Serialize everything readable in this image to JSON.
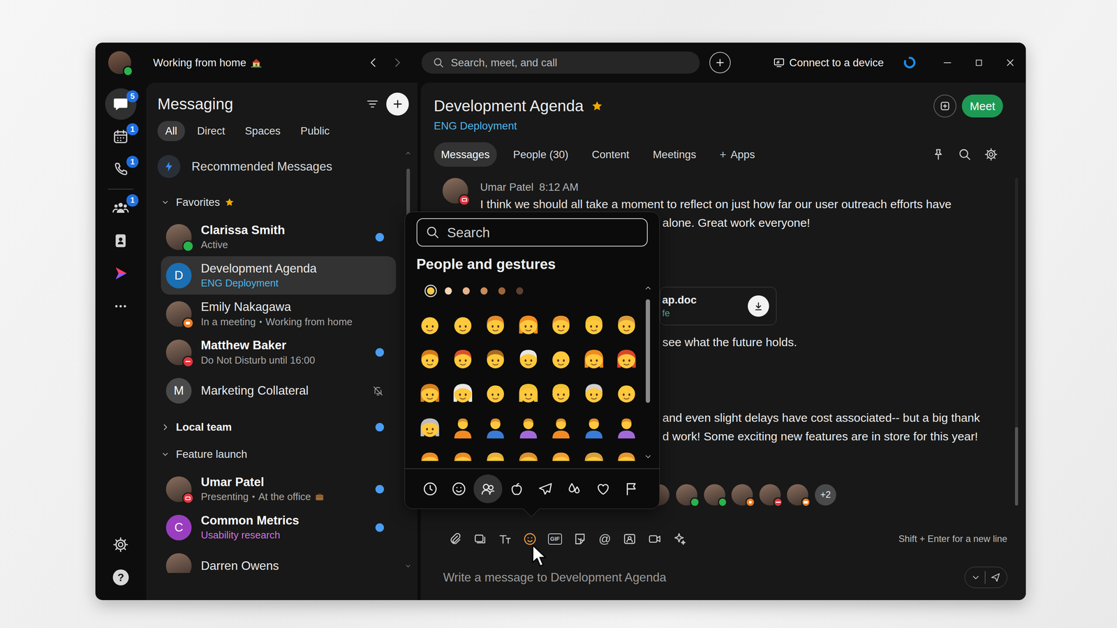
{
  "topbar": {
    "status": "Working from home",
    "status_icon": true,
    "presence": "active",
    "back_enabled": true,
    "forward_enabled": false,
    "search_placeholder": "Search, meet, and call",
    "connect": "Connect to a device"
  },
  "rail": {
    "items": [
      {
        "kind": "chat",
        "badge": "5",
        "selected": true
      },
      {
        "kind": "calendar",
        "badge": "1",
        "selected": false
      },
      {
        "kind": "calls",
        "badge": "1",
        "selected": false
      },
      {
        "kind": "teams",
        "badge": "1",
        "selected": false
      },
      {
        "kind": "contacts",
        "badge": null,
        "selected": false
      },
      {
        "kind": "app",
        "badge": null,
        "selected": false
      },
      {
        "kind": "more",
        "badge": null,
        "selected": false
      }
    ],
    "bottom": [
      {
        "kind": "settings",
        "glyph": null
      },
      {
        "kind": "help",
        "glyph": "?"
      }
    ]
  },
  "messaging": {
    "title": "Messaging",
    "filters": [
      {
        "label": "All",
        "selected": true
      },
      {
        "label": "Direct",
        "selected": false
      },
      {
        "label": "Spaces",
        "selected": false
      },
      {
        "label": "Public",
        "selected": false
      }
    ],
    "recommended": "Recommended Messages",
    "subtitle_separator": "•",
    "sections": [
      {
        "title": "Favorites",
        "expanded": true,
        "starred": true,
        "unread": false,
        "items": [
          {
            "name": "Clarissa Smith",
            "subtitle": [
              "Active"
            ],
            "subtitle_color": null,
            "status_icon": false,
            "avatar": {
              "kind": "photo"
            },
            "presence": "active",
            "unread": true,
            "muted": false,
            "selected": false
          },
          {
            "name": "Development Agenda",
            "subtitle": [
              "ENG Deployment"
            ],
            "subtitle_color": "#4fb6e8",
            "status_icon": false,
            "avatar": {
              "kind": "letter",
              "initial": "D",
              "color": "#1b6fb3"
            },
            "presence": "none",
            "unread": false,
            "muted": false,
            "selected": true
          },
          {
            "name": "Emily Nakagawa",
            "subtitle": [
              "In a meeting",
              "Working from home"
            ],
            "subtitle_color": null,
            "status_icon": false,
            "avatar": {
              "kind": "photo"
            },
            "presence": "meeting",
            "unread": false,
            "muted": false,
            "selected": false
          },
          {
            "name": "Matthew Baker",
            "subtitle": [
              "Do Not Disturb until 16:00"
            ],
            "subtitle_color": null,
            "status_icon": false,
            "avatar": {
              "kind": "photo"
            },
            "presence": "dnd",
            "unread": true,
            "muted": false,
            "selected": false
          },
          {
            "name": "Marketing Collateral",
            "subtitle": [],
            "subtitle_color": null,
            "status_icon": false,
            "avatar": {
              "kind": "letter",
              "initial": "M",
              "color": "#4a4a4a"
            },
            "presence": "none",
            "unread": false,
            "muted": true,
            "selected": false
          }
        ]
      },
      {
        "title": "Local team",
        "expanded": false,
        "starred": false,
        "unread": true,
        "items": []
      },
      {
        "title": "Feature launch",
        "expanded": true,
        "starred": false,
        "unread": false,
        "items": [
          {
            "name": "Umar Patel",
            "subtitle": [
              "Presenting",
              "At the office"
            ],
            "subtitle_color": null,
            "status_icon": true,
            "avatar": {
              "kind": "photo"
            },
            "presence": "presenting",
            "unread": true,
            "muted": false,
            "selected": false
          },
          {
            "name": "Common Metrics",
            "subtitle": [
              "Usability research"
            ],
            "subtitle_color": "#cf72e6",
            "status_icon": false,
            "avatar": {
              "kind": "letter",
              "initial": "C",
              "color": "#9a3ec0"
            },
            "presence": "none",
            "unread": true,
            "muted": false,
            "selected": false
          },
          {
            "name": "Darren Owens",
            "subtitle": [],
            "subtitle_color": null,
            "status_icon": false,
            "avatar": {
              "kind": "photo"
            },
            "presence": "none",
            "unread": false,
            "muted": false,
            "selected": false
          }
        ]
      }
    ]
  },
  "space": {
    "title": "Development Agenda",
    "favorite": true,
    "subtitle": "ENG Deployment",
    "meet": "Meet",
    "tabs": [
      {
        "label": "Messages",
        "prefix": null,
        "selected": true
      },
      {
        "label": "People (30)",
        "prefix": null,
        "selected": false
      },
      {
        "label": "Content",
        "prefix": null,
        "selected": false
      },
      {
        "label": "Meetings",
        "prefix": null,
        "selected": false
      },
      {
        "label": "Apps",
        "prefix": "+",
        "selected": false
      }
    ],
    "tools": [
      {
        "kind": "pin"
      },
      {
        "kind": "search"
      },
      {
        "kind": "settings"
      }
    ]
  },
  "message": {
    "author": "Umar Patel",
    "time": "8:12 AM",
    "presence": "presenting",
    "body": [
      {
        "kind": "text",
        "text": "I think we should all take a moment to reflect on just how far our user outreach efforts have"
      },
      {
        "kind": "text",
        "text": "alone. Great work everyone!"
      },
      {
        "kind": "file",
        "name": "ap.doc",
        "meta": "fe"
      },
      {
        "kind": "text",
        "text": "see what the future holds."
      },
      {
        "kind": "text",
        "text": "and even slight delays have cost associated-- but a big thank"
      },
      {
        "kind": "text",
        "text": "d work! Some exciting new features are in store for this year!"
      }
    ],
    "readers": [
      {
        "presence": "none"
      },
      {
        "presence": "active"
      },
      {
        "presence": "active"
      },
      {
        "presence": "calling"
      },
      {
        "presence": "dnd"
      },
      {
        "presence": "meeting"
      }
    ],
    "more_readers": "+2"
  },
  "composer": {
    "tools": [
      {
        "kind": "attach",
        "glyph": null,
        "selected": false
      },
      {
        "kind": "screenshot",
        "glyph": null,
        "selected": false
      },
      {
        "kind": "format",
        "glyph": null,
        "selected": false
      },
      {
        "kind": "emoji",
        "glyph": null,
        "selected": true
      },
      {
        "kind": "gif",
        "glyph": "GIF",
        "selected": false
      },
      {
        "kind": "sticker",
        "glyph": null,
        "selected": false
      },
      {
        "kind": "mention",
        "glyph": "@",
        "selected": false
      },
      {
        "kind": "contact",
        "glyph": null,
        "selected": false
      },
      {
        "kind": "video",
        "glyph": null,
        "selected": false
      },
      {
        "kind": "ai",
        "glyph": null,
        "selected": false
      }
    ],
    "hint": "Shift + Enter for a new line",
    "placeholder": "Write a message to Development Agenda"
  },
  "picker": {
    "open": true,
    "search_placeholder": "Search",
    "heading": "People and gestures",
    "skin_tones": [
      {
        "color": "#f7c948",
        "selected": true
      },
      {
        "color": "#f5d6b4",
        "selected": false
      },
      {
        "color": "#e6b48a",
        "selected": false
      },
      {
        "color": "#c78c5c",
        "selected": false
      },
      {
        "color": "#9c653b",
        "selected": false
      },
      {
        "color": "#5e4030",
        "selected": false
      }
    ],
    "emojis": [
      {
        "kind": "bald"
      },
      {
        "kind": "bald"
      },
      {
        "kind": "face",
        "color": "#e08a2c"
      },
      {
        "kind": "long",
        "color": "#f08c22"
      },
      {
        "kind": "face",
        "color": "#e8962e"
      },
      {
        "kind": "face",
        "color": "#f2c233"
      },
      {
        "kind": "face",
        "color": "#d89a3c"
      },
      {
        "kind": "face",
        "color": "#d47a1a"
      },
      {
        "kind": "face",
        "color": "#d9512a"
      },
      {
        "kind": "face",
        "color": "#a86a20"
      },
      {
        "kind": "face",
        "color": "#e6e6e6"
      },
      {
        "kind": "bald"
      },
      {
        "kind": "long",
        "color": "#ef8a20"
      },
      {
        "kind": "long",
        "color": "#d9452a"
      },
      {
        "kind": "long",
        "color": "#d67f1f"
      },
      {
        "kind": "long",
        "color": "#e8e8e8"
      },
      {
        "kind": "bald"
      },
      {
        "kind": "long",
        "color": "#f2c233"
      },
      {
        "kind": "face",
        "color": "#f2c233"
      },
      {
        "kind": "face",
        "color": "#cfcfcf"
      },
      {
        "kind": "bald"
      },
      {
        "kind": "long",
        "color": "#bdbdbd"
      },
      {
        "kind": "bust",
        "color": "#f08a24"
      },
      {
        "kind": "bust",
        "color": "#3a7bd5"
      },
      {
        "kind": "bust",
        "color": "#a26ad8"
      },
      {
        "kind": "bust",
        "color": "#f08a24"
      },
      {
        "kind": "bust",
        "color": "#3a7bd5"
      },
      {
        "kind": "bust",
        "color": "#a26ad8"
      },
      {
        "kind": "face",
        "color": "#f08a24"
      },
      {
        "kind": "face",
        "color": "#f08a24"
      },
      {
        "kind": "face",
        "color": "#e6b23a"
      },
      {
        "kind": "long",
        "color": "#e0902c"
      },
      {
        "kind": "face",
        "color": "#f0a030"
      },
      {
        "kind": "long",
        "color": "#d9a03c"
      },
      {
        "kind": "face",
        "color": "#e8962e"
      }
    ],
    "categories": [
      {
        "kind": "clock",
        "selected": false
      },
      {
        "kind": "emoji",
        "selected": false
      },
      {
        "kind": "people",
        "selected": true
      },
      {
        "kind": "apple",
        "selected": false
      },
      {
        "kind": "plane",
        "selected": false
      },
      {
        "kind": "drops",
        "selected": false
      },
      {
        "kind": "heart",
        "selected": false
      },
      {
        "kind": "flag",
        "selected": false
      }
    ]
  }
}
